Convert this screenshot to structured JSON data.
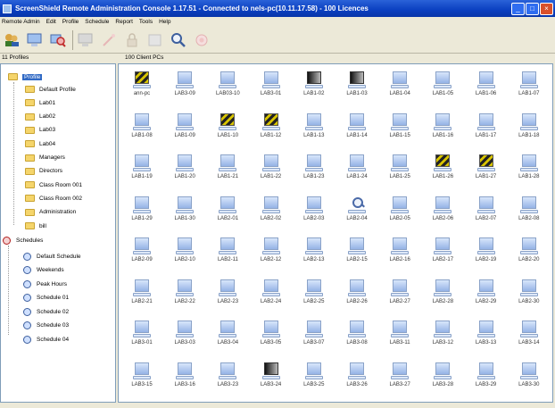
{
  "window": {
    "title": "ScreenShield Remote Administration Console 1.17.51 - Connected to nels-pc(10.11.17.58) - 100 Licences"
  },
  "menu": [
    "Remote Admin",
    "Edit",
    "Profile",
    "Schedule",
    "Report",
    "Tools",
    "Help"
  ],
  "toolbar": {
    "icons": [
      "profile-users-icon",
      "monitor-icon",
      "search-computer-icon",
      "disabled-monitor-icon",
      "disabled-wand-icon",
      "disabled-lock-icon",
      "disabled-view-icon",
      "magnifier-icon",
      "disabled-target-icon"
    ]
  },
  "left_panel": {
    "header": "11 Profiles"
  },
  "right_panel": {
    "header": "100 Client PCs"
  },
  "tree": {
    "profiles_root": "Profile",
    "profiles": [
      "Default Profile",
      "Lab01",
      "Lab02",
      "Lab03",
      "Lab04",
      "Managers",
      "Directors",
      "Class Room 001",
      "Class Room 002",
      "Administration",
      "bill"
    ],
    "schedules_root": "Schedules",
    "schedules": [
      "Default Schedule",
      "Weekends",
      "Peak Hours",
      "Schedule 01",
      "Schedule 02",
      "Schedule 03",
      "Schedule 04"
    ]
  },
  "pcs": [
    {
      "label": "ann-pc",
      "state": "warn"
    },
    {
      "label": "LAB3-09",
      "state": "normal"
    },
    {
      "label": "LAB03-10",
      "state": "normal"
    },
    {
      "label": "LAB3-01",
      "state": "normal"
    },
    {
      "label": "LAB1-02",
      "state": "dark"
    },
    {
      "label": "LAB1-03",
      "state": "dark"
    },
    {
      "label": "LAB1-04",
      "state": "normal"
    },
    {
      "label": "LAB1-05",
      "state": "normal"
    },
    {
      "label": "LAB1-06",
      "state": "normal"
    },
    {
      "label": "LAB1-07",
      "state": "normal"
    },
    {
      "label": "LAB1-08",
      "state": "normal"
    },
    {
      "label": "LAB1-09",
      "state": "normal"
    },
    {
      "label": "LAB1-10",
      "state": "warn"
    },
    {
      "label": "LAB1-12",
      "state": "warn"
    },
    {
      "label": "LAB1-13",
      "state": "normal"
    },
    {
      "label": "LAB1-14",
      "state": "normal"
    },
    {
      "label": "LAB1-15",
      "state": "normal"
    },
    {
      "label": "LAB1-16",
      "state": "normal"
    },
    {
      "label": "LAB1-17",
      "state": "normal"
    },
    {
      "label": "LAB1-18",
      "state": "normal"
    },
    {
      "label": "LAB1-19",
      "state": "normal"
    },
    {
      "label": "LAB1-20",
      "state": "normal"
    },
    {
      "label": "LAB1-21",
      "state": "normal"
    },
    {
      "label": "LAB1-22",
      "state": "normal"
    },
    {
      "label": "LAB1-23",
      "state": "normal"
    },
    {
      "label": "LAB1-24",
      "state": "normal"
    },
    {
      "label": "LAB1-25",
      "state": "normal"
    },
    {
      "label": "LAB1-26",
      "state": "warn"
    },
    {
      "label": "LAB1-27",
      "state": "warn"
    },
    {
      "label": "LAB1-28",
      "state": "normal"
    },
    {
      "label": "LAB1-29",
      "state": "normal"
    },
    {
      "label": "LAB1-30",
      "state": "normal"
    },
    {
      "label": "LAB2-01",
      "state": "normal"
    },
    {
      "label": "LAB2-02",
      "state": "normal"
    },
    {
      "label": "LAB2-03",
      "state": "normal"
    },
    {
      "label": "LAB2-04",
      "state": "search"
    },
    {
      "label": "LAB2-05",
      "state": "normal"
    },
    {
      "label": "LAB2-06",
      "state": "normal"
    },
    {
      "label": "LAB2-07",
      "state": "normal"
    },
    {
      "label": "LAB2-08",
      "state": "normal"
    },
    {
      "label": "LAB2-09",
      "state": "normal"
    },
    {
      "label": "LAB2-10",
      "state": "normal"
    },
    {
      "label": "LAB2-11",
      "state": "normal"
    },
    {
      "label": "LAB2-12",
      "state": "normal"
    },
    {
      "label": "LAB2-13",
      "state": "normal"
    },
    {
      "label": "LAB2-15",
      "state": "normal"
    },
    {
      "label": "LAB2-16",
      "state": "normal"
    },
    {
      "label": "LAB2-17",
      "state": "normal"
    },
    {
      "label": "LAB2-19",
      "state": "normal"
    },
    {
      "label": "LAB2-20",
      "state": "normal"
    },
    {
      "label": "LAB2-21",
      "state": "normal"
    },
    {
      "label": "LAB2-22",
      "state": "normal"
    },
    {
      "label": "LAB2-23",
      "state": "normal"
    },
    {
      "label": "LAB2-24",
      "state": "normal"
    },
    {
      "label": "LAB2-25",
      "state": "normal"
    },
    {
      "label": "LAB2-26",
      "state": "normal"
    },
    {
      "label": "LAB2-27",
      "state": "normal"
    },
    {
      "label": "LAB2-28",
      "state": "normal"
    },
    {
      "label": "LAB2-29",
      "state": "normal"
    },
    {
      "label": "LAB2-30",
      "state": "normal"
    },
    {
      "label": "LAB3-01",
      "state": "normal"
    },
    {
      "label": "LAB3-03",
      "state": "normal"
    },
    {
      "label": "LAB3-04",
      "state": "normal"
    },
    {
      "label": "LAB3-05",
      "state": "normal"
    },
    {
      "label": "LAB3-07",
      "state": "normal"
    },
    {
      "label": "LAB3-08",
      "state": "normal"
    },
    {
      "label": "LAB3-11",
      "state": "normal"
    },
    {
      "label": "LAB3-12",
      "state": "normal"
    },
    {
      "label": "LAB3-13",
      "state": "normal"
    },
    {
      "label": "LAB3-14",
      "state": "normal"
    },
    {
      "label": "LAB3-15",
      "state": "normal"
    },
    {
      "label": "LAB3-16",
      "state": "normal"
    },
    {
      "label": "LAB3-23",
      "state": "normal"
    },
    {
      "label": "LAB3-24",
      "state": "dark"
    },
    {
      "label": "LAB3-25",
      "state": "normal"
    },
    {
      "label": "LAB3-26",
      "state": "normal"
    },
    {
      "label": "LAB3-27",
      "state": "normal"
    },
    {
      "label": "LAB3-28",
      "state": "normal"
    },
    {
      "label": "LAB3-29",
      "state": "normal"
    },
    {
      "label": "LAB3-30",
      "state": "normal"
    }
  ]
}
